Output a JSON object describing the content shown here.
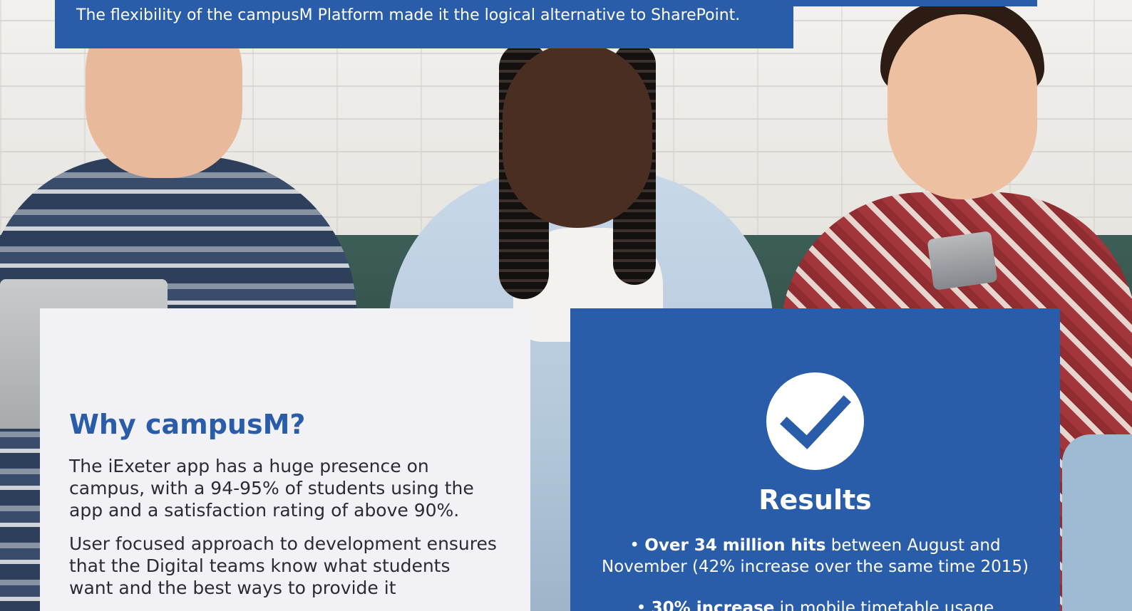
{
  "banner": {
    "text": "The flexibility of the campusM Platform made it the logical alternative to SharePoint."
  },
  "why": {
    "heading": "Why campusM?",
    "paragraphs": [
      "The iExeter app has a huge presence on campus, with a 94-95% of students using the app and a satisfaction rating of above 90%.",
      "User focused approach to development ensures that the Digital teams know what students want and the best ways to provide it"
    ]
  },
  "results": {
    "heading": "Results",
    "items": [
      {
        "bullet": "•",
        "bold": "Over 34 million hits",
        "rest": " between August and November (42% increase over the same time 2015)"
      },
      {
        "bullet": "•",
        "bold": "30% increase",
        "rest": " in mobile timetable usage"
      }
    ]
  },
  "colors": {
    "brand_blue": "#2a5da9",
    "card_light": "#f1f1f6",
    "text_dark": "#2b2b33",
    "white": "#ffffff"
  },
  "icons": {
    "results_icon": "checkmark-circle-icon"
  }
}
